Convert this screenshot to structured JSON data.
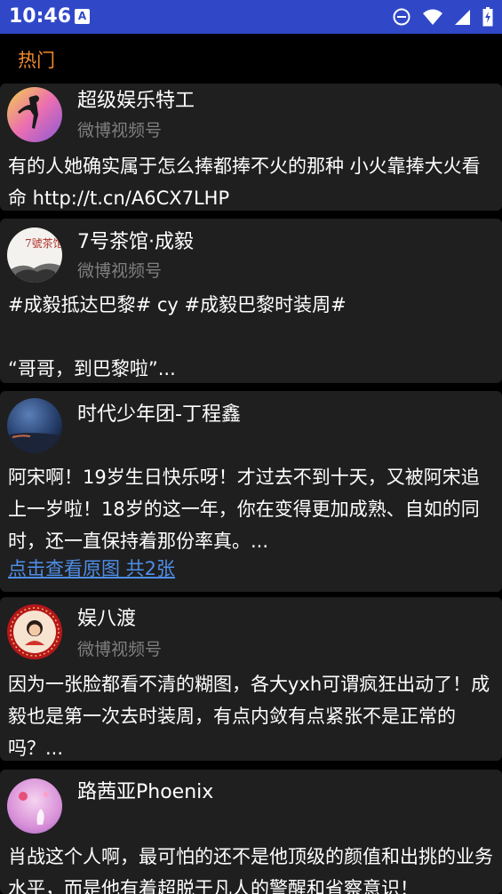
{
  "status_bar": {
    "time": "10:46",
    "notification_glyph": "A"
  },
  "header": {
    "title": "热门"
  },
  "feed": [
    {
      "name": "超级娱乐特工",
      "source": "微博视频号",
      "text": "有的人她确实属于怎么捧都捧不火的那种 小火靠捧大火看命 http://t.cn/A6CX7LHP"
    },
    {
      "name": "7号茶馆·成毅",
      "source": "微博视频号",
      "avatar_glyph": "7號茶馆",
      "text": "#成毅抵达巴黎# cy #成毅巴黎时装周#\n\n“哥哥，到巴黎啦”..."
    },
    {
      "name": "时代少年团-丁程鑫",
      "text": "阿宋啊！19岁生日快乐呀！才过去不到十天，又被阿宋追上一岁啦！18岁的这一年，你在变得更加成熟、自如的同时，还一直保持着那份率真。...",
      "link": "点击查看原图 共2张"
    },
    {
      "name": "娱八渡",
      "source": "微博视频号",
      "text": "因为一张脸都看不清的糊图，各大yxh可谓疯狂出动了！成毅也是第一次去时装周，有点内敛有点紧张不是正常的吗？..."
    },
    {
      "name": "路茜亚Phoenix",
      "text": "肖战这个人啊，最可怕的还不是他顶级的颜值和出挑的业务水平，而是他有着超脱于凡人的警醒和省察意识！"
    }
  ],
  "icons": [
    "do-not-disturb-icon",
    "wifi-icon",
    "signal-icon",
    "battery-icon"
  ],
  "colors": {
    "status_bar": "#3048c8",
    "header_title": "#f08a2c",
    "card_bg": "#1f1f1f",
    "link": "#4e8ee8",
    "secondary_text": "#7f7f7f"
  }
}
